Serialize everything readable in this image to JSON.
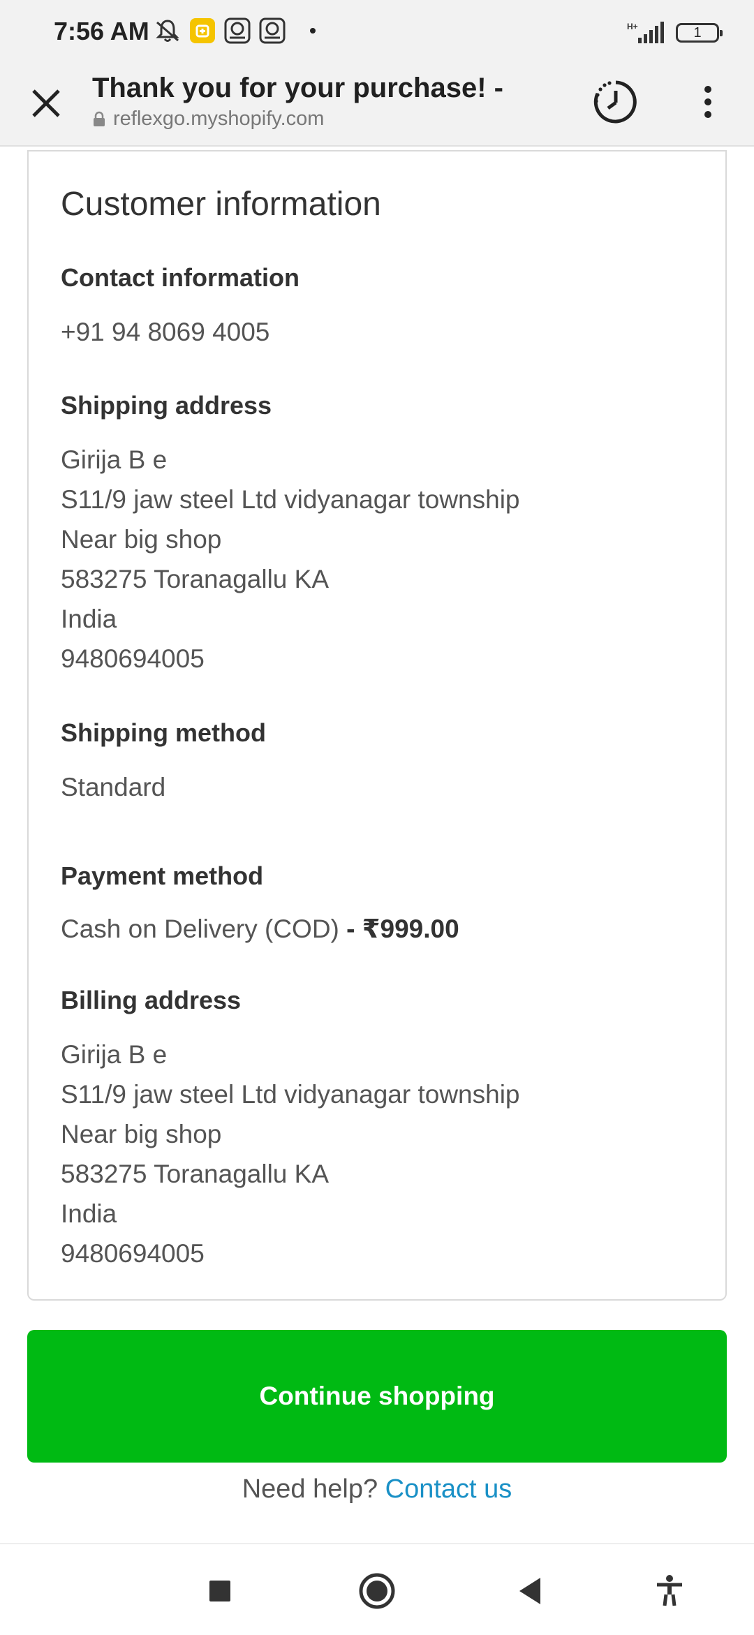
{
  "status_bar": {
    "time": "7:56 AM",
    "left_icons": [
      "mute-icon",
      "app-notification-icon",
      "app-notification-icon",
      "app-notification-icon"
    ],
    "network": "H+",
    "battery_level": "1"
  },
  "toolbar": {
    "title": "Thank you for your purchase! -",
    "url": "reflexgo.myshopify.com",
    "icons": [
      "close-icon",
      "lock-icon",
      "history-icon",
      "more-vert-icon"
    ]
  },
  "customer_info": {
    "title": "Customer information",
    "contact": {
      "heading": "Contact information",
      "phone": "+91 94 8069 4005"
    },
    "shipping_address": {
      "heading": "Shipping address",
      "lines": [
        "Girija B e",
        "S11/9 jaw steel Ltd vidyanagar township",
        "Near big shop",
        "583275 Toranagallu KA",
        "India",
        "9480694005"
      ]
    },
    "shipping_method": {
      "heading": "Shipping method",
      "value": "Standard"
    },
    "payment_method": {
      "heading": "Payment method",
      "value": "Cash on Delivery (COD)",
      "amount": " - ₹999.00"
    },
    "billing_address": {
      "heading": "Billing address",
      "lines": [
        "Girija B e",
        "S11/9 jaw steel Ltd vidyanagar township",
        "Near big shop",
        "583275 Toranagallu KA",
        "India",
        "9480694005"
      ]
    }
  },
  "actions": {
    "continue_label": "Continue shopping",
    "help_text": "Need help? ",
    "contact_link": "Contact us"
  },
  "colors": {
    "accent_green": "#00ba13",
    "link_blue": "#1990c6"
  },
  "nav_bar": {
    "icons": [
      "recents-square-icon",
      "home-circle-icon",
      "back-triangle-icon",
      "accessibility-icon"
    ]
  }
}
